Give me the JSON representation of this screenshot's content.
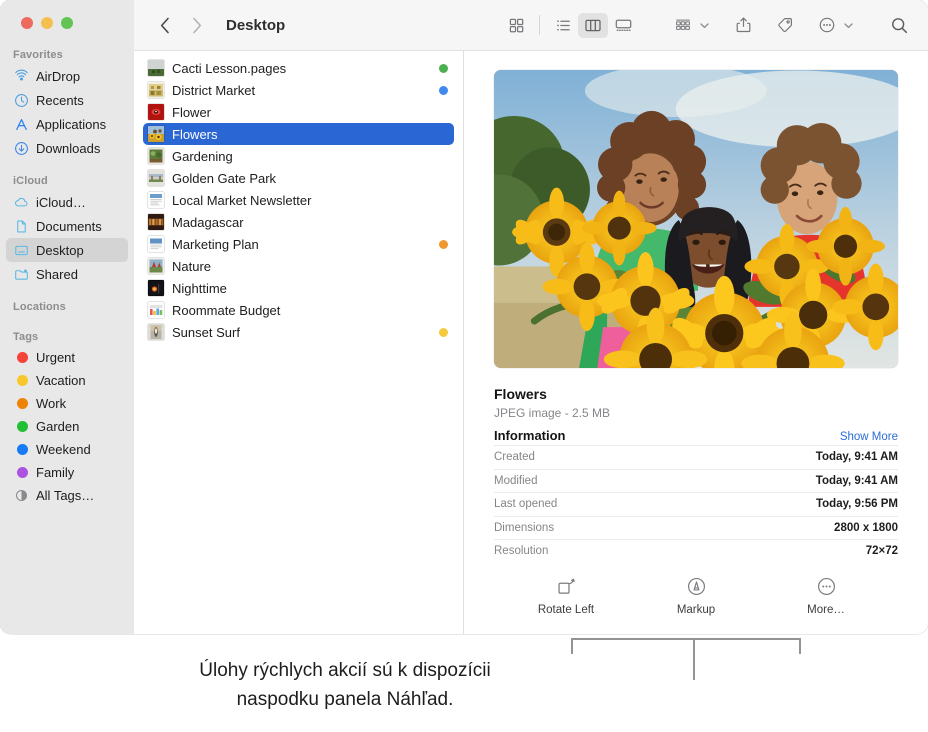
{
  "window": {
    "title": "Desktop",
    "traffic_lights": [
      {
        "name": "close",
        "color": "#ec6a5e"
      },
      {
        "name": "minimize",
        "color": "#f4bf4f"
      },
      {
        "name": "zoom",
        "color": "#61c454"
      }
    ]
  },
  "toolbar": {
    "back_label": "‹",
    "forward_label": "›",
    "view_buttons": [
      {
        "id": "icon-view",
        "name": "icon-view-button",
        "active": false
      },
      {
        "id": "list-view",
        "name": "list-view-button",
        "active": false
      },
      {
        "id": "column-view",
        "name": "column-view-button",
        "active": true
      },
      {
        "id": "gallery-view",
        "name": "gallery-view-button",
        "active": false
      }
    ],
    "group_by_label": "group-by",
    "share_label": "share",
    "tags_label": "tags",
    "more_label": "more-actions",
    "search_label": "search"
  },
  "sidebar": {
    "sections": [
      {
        "header": "Favorites",
        "items": [
          {
            "label": "AirDrop",
            "icon": "airdrop-icon",
            "selected": false
          },
          {
            "label": "Recents",
            "icon": "clock-icon",
            "selected": false
          },
          {
            "label": "Applications",
            "icon": "applications-icon",
            "selected": false
          },
          {
            "label": "Downloads",
            "icon": "download-icon",
            "selected": false
          }
        ]
      },
      {
        "header": "iCloud",
        "items": [
          {
            "label": "iCloud…",
            "icon": "cloud-icon",
            "selected": false
          },
          {
            "label": "Documents",
            "icon": "document-icon",
            "selected": false
          },
          {
            "label": "Desktop",
            "icon": "desktop-icon",
            "selected": true
          },
          {
            "label": "Shared",
            "icon": "shared-folder-icon",
            "selected": false
          }
        ]
      },
      {
        "header": "Locations",
        "items": []
      },
      {
        "header": "Tags",
        "items": [
          {
            "label": "Urgent",
            "icon": "tag-dot-icon",
            "color": "#f6433a",
            "selected": false
          },
          {
            "label": "Vacation",
            "icon": "tag-dot-icon",
            "color": "#f8c72c",
            "selected": false
          },
          {
            "label": "Work",
            "icon": "tag-dot-icon",
            "color": "#ef8208",
            "selected": false
          },
          {
            "label": "Garden",
            "icon": "tag-dot-icon",
            "color": "#21c034",
            "selected": false
          },
          {
            "label": "Weekend",
            "icon": "tag-dot-icon",
            "color": "#177bf5",
            "selected": false
          },
          {
            "label": "Family",
            "icon": "tag-dot-icon",
            "color": "#ab53e0",
            "selected": false
          },
          {
            "label": "All Tags…",
            "icon": "all-tags-icon",
            "color": "",
            "selected": false
          }
        ]
      }
    ]
  },
  "file_list": [
    {
      "name": "Cacti Lesson.pages",
      "icon": "image-thumbnail-cacti",
      "tag_color": "#4caf50",
      "selected": false
    },
    {
      "name": "District Market",
      "icon": "image-thumbnail-market",
      "tag_color": "#4188ef",
      "selected": false
    },
    {
      "name": "Flower",
      "icon": "image-thumbnail-flower",
      "tag_color": "",
      "selected": false
    },
    {
      "name": "Flowers",
      "icon": "image-thumbnail-flowers",
      "tag_color": "",
      "selected": true
    },
    {
      "name": "Gardening",
      "icon": "image-thumbnail-gardening",
      "tag_color": "",
      "selected": false
    },
    {
      "name": "Golden Gate Park",
      "icon": "image-thumbnail-ggpark",
      "tag_color": "",
      "selected": false
    },
    {
      "name": "Local Market Newsletter",
      "icon": "document-thumbnail-news",
      "tag_color": "",
      "selected": false
    },
    {
      "name": "Madagascar",
      "icon": "image-thumbnail-madagascar",
      "tag_color": "",
      "selected": false
    },
    {
      "name": "Marketing Plan",
      "icon": "document-thumbnail-plan",
      "tag_color": "#f0982c",
      "selected": false
    },
    {
      "name": "Nature",
      "icon": "image-thumbnail-nature",
      "tag_color": "",
      "selected": false
    },
    {
      "name": "Nighttime",
      "icon": "image-thumbnail-night",
      "tag_color": "",
      "selected": false
    },
    {
      "name": "Roommate Budget",
      "icon": "document-thumbnail-budget",
      "tag_color": "",
      "selected": false
    },
    {
      "name": "Sunset Surf",
      "icon": "image-thumbnail-surf",
      "tag_color": "#f5ca3c",
      "selected": false
    }
  ],
  "preview": {
    "image_alt": "Three people holding large bouquets of sunflowers in a field",
    "file_title": "Flowers",
    "file_subtitle": "JPEG image - 2.5 MB",
    "info_title": "Information",
    "show_more": "Show More",
    "info_rows": [
      {
        "key": "Created",
        "value": "Today, 9:41 AM"
      },
      {
        "key": "Modified",
        "value": "Today, 9:41 AM"
      },
      {
        "key": "Last opened",
        "value": "Today, 9:56 PM"
      },
      {
        "key": "Dimensions",
        "value": "2800 x 1800"
      },
      {
        "key": "Resolution",
        "value": "72×72"
      }
    ],
    "quick_actions": [
      {
        "label": "Rotate Left",
        "icon": "rotate-left-icon"
      },
      {
        "label": "Markup",
        "icon": "markup-icon"
      },
      {
        "label": "More…",
        "icon": "more-circle-icon"
      }
    ]
  },
  "callout": {
    "line1": "Úlohy rýchlych akcií sú k dispozícii",
    "line2": "naspodku panela Náhľad."
  }
}
